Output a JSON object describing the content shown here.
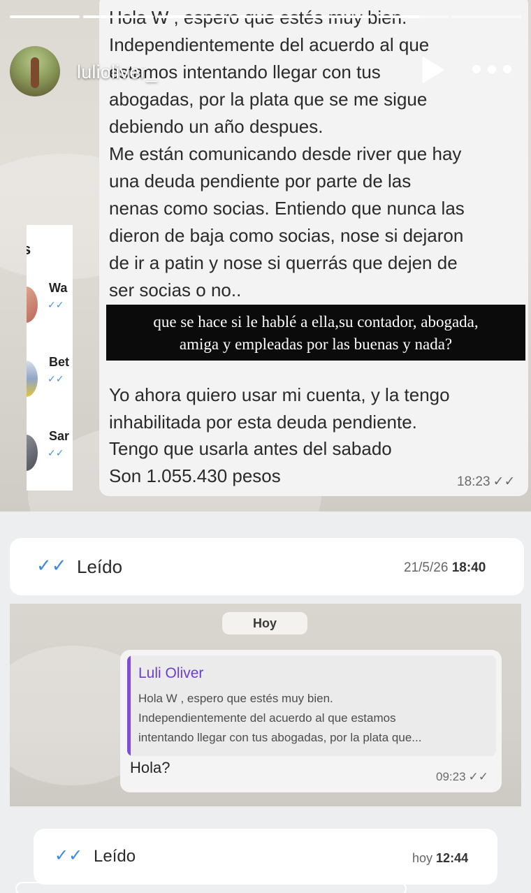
{
  "story": {
    "username": "lulioliver_",
    "progress_segments": [
      1,
      1,
      1,
      1,
      1,
      0.6,
      0
    ]
  },
  "icons": {
    "play": "play-icon",
    "more": "more-horizontal-icon",
    "read_ticks": "double-check-icon"
  },
  "side_list": {
    "header": "s",
    "items": [
      {
        "name": "Wa",
        "status": "✓✓"
      },
      {
        "name": "Bet",
        "status": "✓✓"
      },
      {
        "name": "Sar",
        "status": "✓✓"
      }
    ]
  },
  "message_main": {
    "text_part1": "Hola W      , espero que estés muy bien.\nIndependientemente del acuerdo al que\nestamos intentando llegar con tus\nabogadas, por la plata que se me sigue\ndebiendo un año despues.\nMe están comunicando desde river que hay\nuna deuda pendiente por parte de las\nnenas como socias. Entiendo que nunca las\ndieron de baja como socias, nose si dejaron\nde ir a patin y nose si querrás que dejen de\nser socias o no..",
    "text_part2": "Yo ahora quiero usar mi cuenta, y la tengo\ninhabilitada por esta deuda pendiente.\nTengo que usarla antes del sabado\nSon 1.055.430 pesos",
    "time": "18:23"
  },
  "caption": {
    "line1": "que se hace si le hablé a ella,su contador, abogada,",
    "line2": "amiga y empleadas por las buenas y nada?"
  },
  "read_receipt_1": {
    "label": "Leído",
    "date": "21/5/26",
    "time": "18:40"
  },
  "chat2": {
    "date_pill": "Hoy",
    "quote_author": "Luli Oliver",
    "quote_text": "Hola W        , espero que estés muy bien.\nIndependientemente del acuerdo al que estamos\nintentando llegar con tus abogadas, por la plata que...",
    "reply": "Hola?",
    "time": "09:23"
  },
  "read_receipt_2": {
    "label": "Leído",
    "date": "hoy",
    "time": "12:44"
  },
  "colors": {
    "tick_blue": "#3d88e0",
    "quote_purple": "#6a3fd0",
    "caption_bg": "#0b0b0b"
  }
}
